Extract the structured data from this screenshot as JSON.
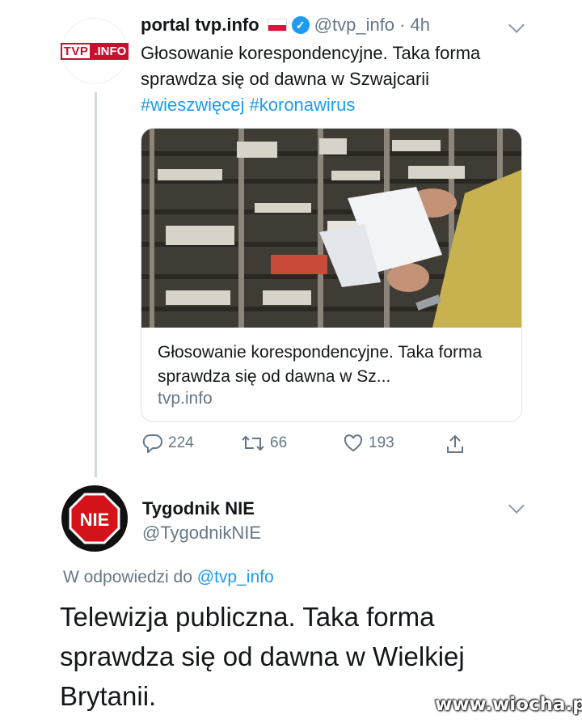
{
  "tweet1": {
    "author_name": "portal tvp.info",
    "handle": "@tvp_info",
    "time": "· 4h",
    "avatar_logo": "TVP.INFO",
    "text": "Głosowanie korespondencyjne. Taka forma sprawdza się od dawna w Szwajcarii",
    "hashtags": [
      "#wieszwięcej",
      "#koronawirus"
    ],
    "card": {
      "title": "Głosowanie korespondencyjne. Taka forma sprawdza się od dawna w Sz...",
      "domain": "tvp.info"
    },
    "stats": {
      "replies": "224",
      "retweets": "66",
      "likes": "193"
    },
    "icons": {
      "reply": "reply-icon",
      "retweet": "retweet-icon",
      "like": "heart-icon",
      "share": "share-icon",
      "more": "chevron-down-icon",
      "verified": "verified-badge-icon",
      "flag": "poland-flag-icon"
    }
  },
  "tweet2": {
    "author_name": "Tygodnik NIE",
    "handle": "@TygodnikNIE",
    "avatar_text": "NIE",
    "reply_prefix": "W odpowiedzi do",
    "reply_to": "@tvp_info",
    "text": "Telewizja publiczna. Taka forma sprawdza się od dawna w Wielkiej Brytanii."
  },
  "watermark": "www.wiocha.pl",
  "colors": {
    "link": "#1d9bf0",
    "secondary": "#657786",
    "tvp_red": "#c8102e",
    "nie_red": "#d3121a"
  }
}
